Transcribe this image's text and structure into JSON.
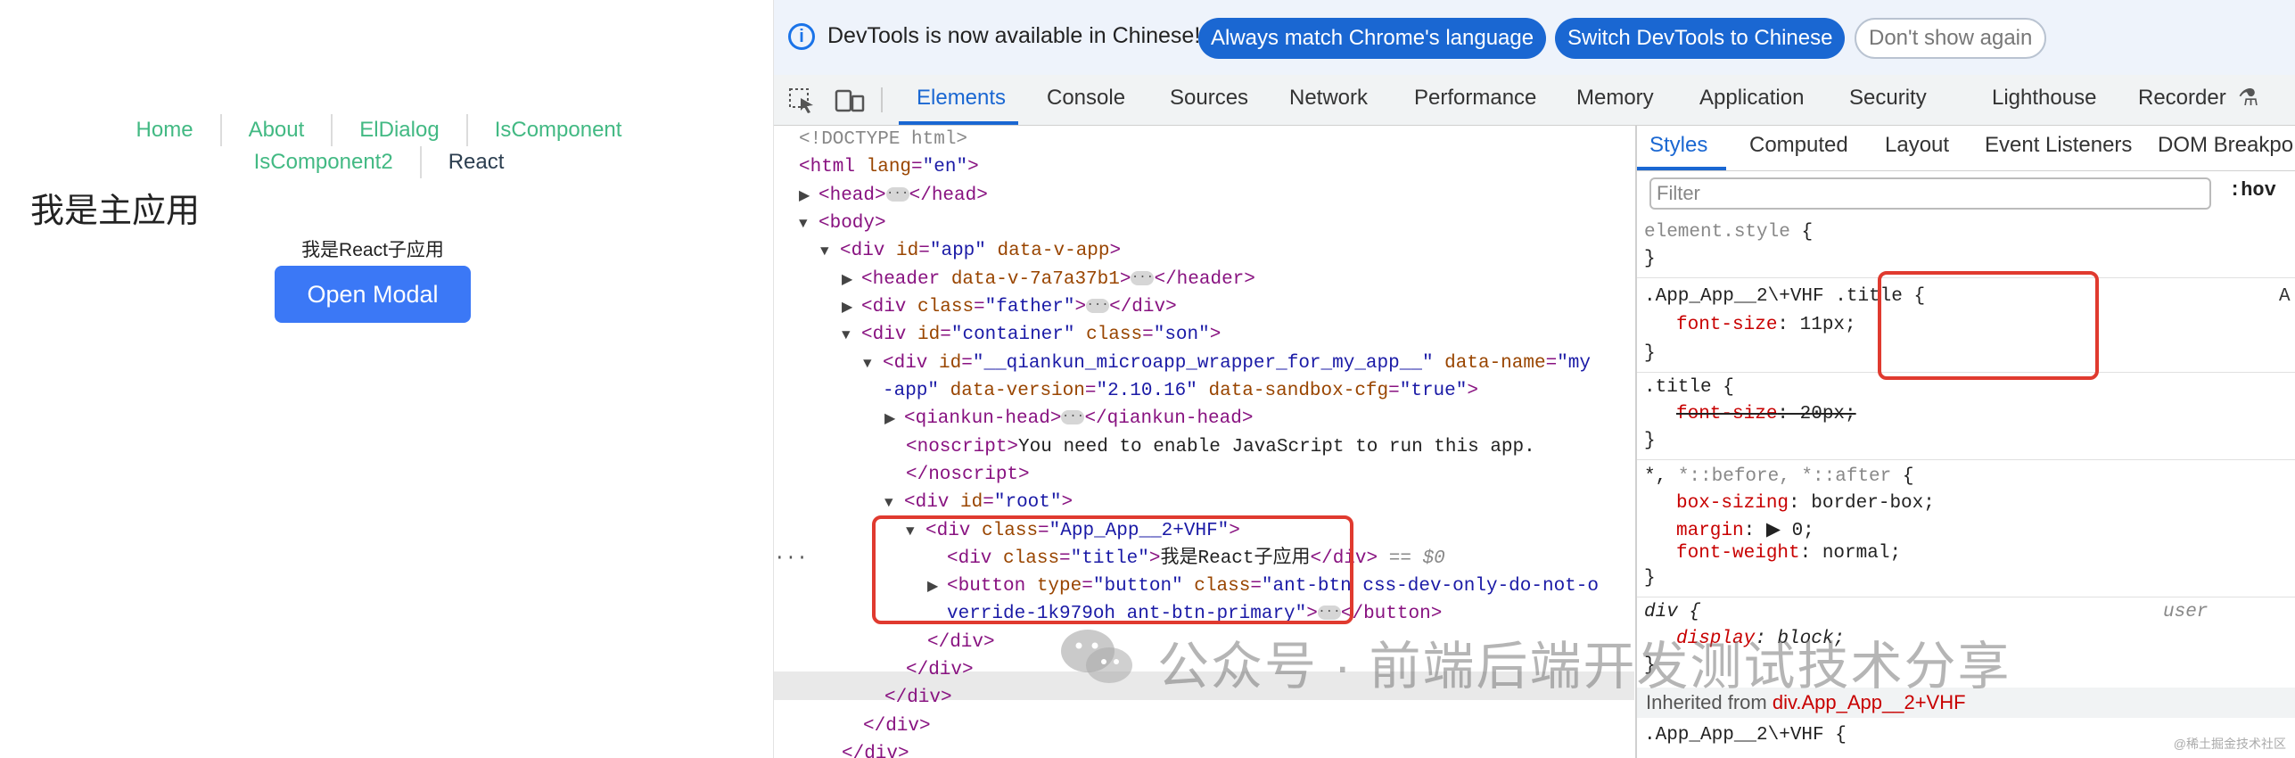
{
  "app": {
    "nav": [
      "Home",
      "About",
      "ElDialog",
      "IsComponent",
      "IsComponent2",
      "React"
    ],
    "main_title": "我是主应用",
    "react_title": "我是React子应用",
    "open_modal": "Open Modal"
  },
  "infobar": {
    "text": "DevTools is now available in Chinese!",
    "btn_match": "Always match Chrome's language",
    "btn_switch": "Switch DevTools to Chinese",
    "btn_dont": "Don't show again"
  },
  "tabs": [
    "Elements",
    "Console",
    "Sources",
    "Network",
    "Performance",
    "Memory",
    "Application",
    "Security",
    "Lighthouse",
    "Recorder"
  ],
  "styles_tabs": [
    "Styles",
    "Computed",
    "Layout",
    "Event Listeners",
    "DOM Breakpo"
  ],
  "filter_placeholder": "Filter",
  "hov": ":hov",
  "inherited": {
    "label": "Inherited from",
    "selector": "div.App_App__2+VHF"
  },
  "watermark": "公众号 · 前端后端开发测试技术分享",
  "corner": "@稀土掘金技术社区",
  "ua": "user",
  "colors": {
    "accent": "#1a67d2",
    "nav_link": "#42b983",
    "highlight": "#e03a2f",
    "button": "#3b78f6"
  }
}
